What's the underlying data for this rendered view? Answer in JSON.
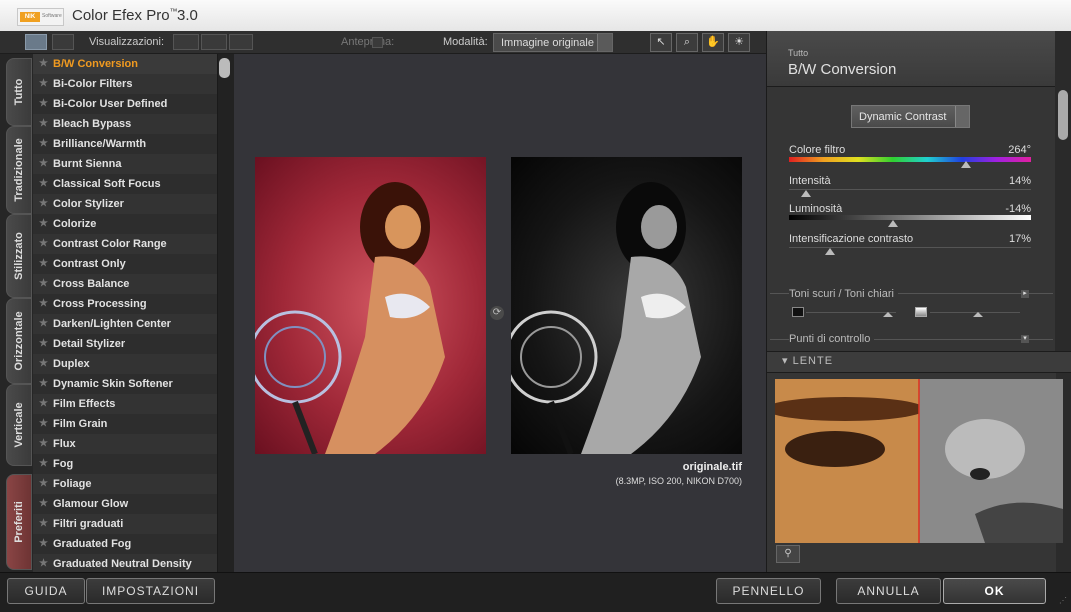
{
  "app": {
    "title": "Color Efex Pro",
    "trademark": "™",
    "version": "3.0",
    "logo_text": "NIK",
    "logo_sub": "Software"
  },
  "toolbar": {
    "views_label": "Visualizzazioni:",
    "preview_label": "Anteprima:",
    "mode_label": "Modalità:",
    "mode_value": "Immagine originale"
  },
  "tabs": [
    "Tutto",
    "Tradizionale",
    "Stilizzato",
    "Orizzontale",
    "Verticale",
    "Preferiti"
  ],
  "filters": [
    "B/W Conversion",
    "Bi-Color Filters",
    "Bi-Color User Defined",
    "Bleach Bypass",
    "Brilliance/Warmth",
    "Burnt Sienna",
    "Classical Soft Focus",
    "Color Stylizer",
    "Colorize",
    "Contrast Color Range",
    "Contrast Only",
    "Cross Balance",
    "Cross Processing",
    "Darken/Lighten Center",
    "Detail Stylizer",
    "Duplex",
    "Dynamic Skin Softener",
    "Film Effects",
    "Film Grain",
    "Flux",
    "Fog",
    "Foliage",
    "Glamour Glow",
    "Filtri graduati",
    "Graduated Fog",
    "Graduated Neutral Density"
  ],
  "active_filter_index": 0,
  "preview": {
    "file_name": "originale.tif",
    "file_info": "(8.3MP, ISO 200, NIKON D700)"
  },
  "panel": {
    "category": "Tutto",
    "filter_title": "B/W Conversion",
    "method": "Dynamic Contrast",
    "sliders": [
      {
        "label": "Colore filtro",
        "value": "264°",
        "level": 0.73
      },
      {
        "label": "Intensità",
        "value": "14%",
        "level": 0.07
      },
      {
        "label": "Luminosità",
        "value": "-14%",
        "level": 0.43
      },
      {
        "label": "Intensificazione contrasto",
        "value": "17%",
        "level": 0.17
      }
    ],
    "tones_label": "Toni scuri / Toni chiari",
    "control_points_label": "Punti di controllo",
    "lens_label": "LENTE"
  },
  "buttons": {
    "guide": "GUIDA",
    "settings": "IMPOSTAZIONI",
    "brush": "PENNELLO",
    "cancel": "ANNULLA",
    "ok": "OK"
  },
  "colors": {
    "active_filter": "#f09a20",
    "favorites_tab": "#7a3c3c"
  }
}
